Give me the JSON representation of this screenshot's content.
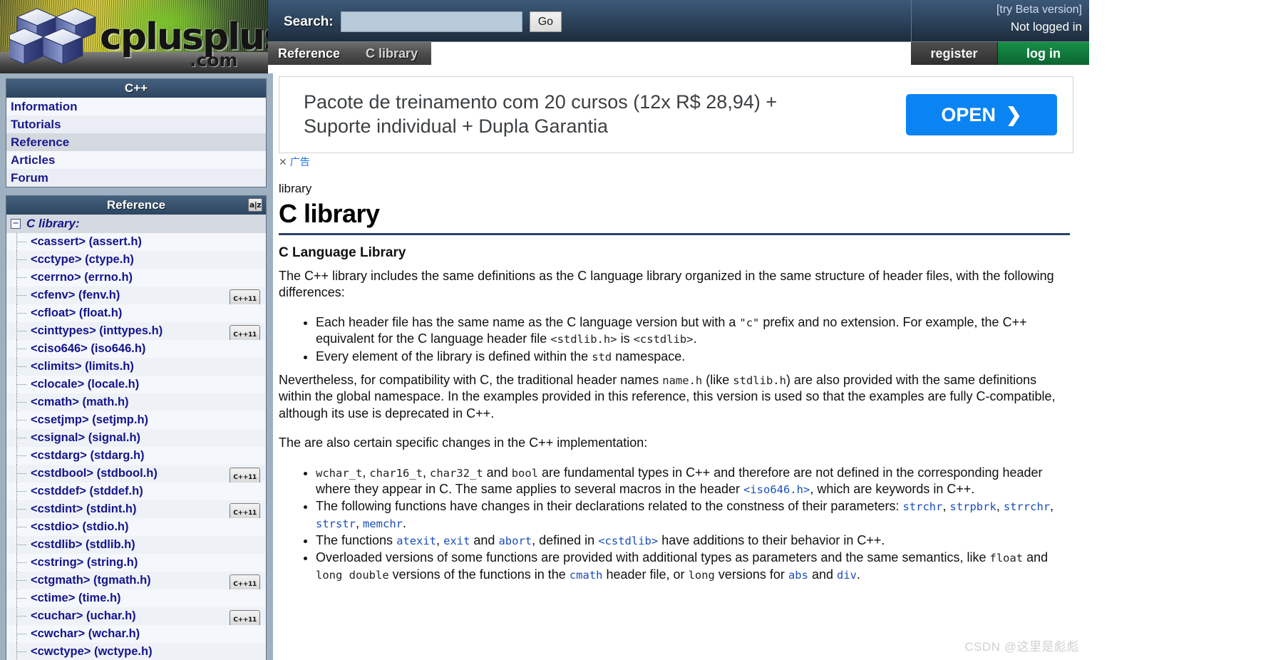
{
  "site": {
    "logo_wordmark": "cplusplus",
    "logo_tld": ".com"
  },
  "header": {
    "search_label": "Search:",
    "search_value": "",
    "search_placeholder": "",
    "go_label": "Go",
    "beta_link": "[try Beta version]",
    "login_status": "Not logged in",
    "register_label": "register",
    "login_label": "log in"
  },
  "tabs": [
    {
      "label": "Reference",
      "current": false
    },
    {
      "label": "C library",
      "current": true
    }
  ],
  "sidebar": {
    "nav_panel": {
      "title": "C++",
      "items": [
        {
          "label": "Information",
          "selected": false
        },
        {
          "label": "Tutorials",
          "selected": false
        },
        {
          "label": "Reference",
          "selected": true
        },
        {
          "label": "Articles",
          "selected": false
        },
        {
          "label": "Forum",
          "selected": false
        }
      ]
    },
    "reference_panel": {
      "title": "Reference",
      "sort_icon": "az-sort-icon",
      "tree_toggle": "−",
      "root_label": "C library:",
      "items": [
        {
          "label": "<cassert> (assert.h)",
          "cpp11": false
        },
        {
          "label": "<cctype> (ctype.h)",
          "cpp11": false
        },
        {
          "label": "<cerrno> (errno.h)",
          "cpp11": false
        },
        {
          "label": "<cfenv> (fenv.h)",
          "cpp11": true
        },
        {
          "label": "<cfloat> (float.h)",
          "cpp11": false
        },
        {
          "label": "<cinttypes> (inttypes.h)",
          "cpp11": true
        },
        {
          "label": "<ciso646> (iso646.h)",
          "cpp11": false
        },
        {
          "label": "<climits> (limits.h)",
          "cpp11": false
        },
        {
          "label": "<clocale> (locale.h)",
          "cpp11": false
        },
        {
          "label": "<cmath> (math.h)",
          "cpp11": false
        },
        {
          "label": "<csetjmp> (setjmp.h)",
          "cpp11": false
        },
        {
          "label": "<csignal> (signal.h)",
          "cpp11": false
        },
        {
          "label": "<cstdarg> (stdarg.h)",
          "cpp11": false
        },
        {
          "label": "<cstdbool> (stdbool.h)",
          "cpp11": true
        },
        {
          "label": "<cstddef> (stddef.h)",
          "cpp11": false
        },
        {
          "label": "<cstdint> (stdint.h)",
          "cpp11": true
        },
        {
          "label": "<cstdio> (stdio.h)",
          "cpp11": false
        },
        {
          "label": "<cstdlib> (stdlib.h)",
          "cpp11": false
        },
        {
          "label": "<cstring> (string.h)",
          "cpp11": false
        },
        {
          "label": "<ctgmath> (tgmath.h)",
          "cpp11": true
        },
        {
          "label": "<ctime> (time.h)",
          "cpp11": false
        },
        {
          "label": "<cuchar> (uchar.h)",
          "cpp11": true
        },
        {
          "label": "<cwchar> (wchar.h)",
          "cpp11": false
        },
        {
          "label": "<cwctype> (wctype.h)",
          "cpp11": false
        }
      ],
      "cpp11_badge": "C++11"
    }
  },
  "ad": {
    "text": "Pacote de treinamento com 20 cursos (12x R$ 28,94) + Suporte individual + Dupla Garantia",
    "open_label": "OPEN",
    "open_arrow": "❯",
    "close_mark": "✕",
    "disclosure": "广告"
  },
  "main": {
    "breadcrumb": "library",
    "title": "C library",
    "section_title": "C Language Library",
    "intro": "The C++ library includes the same definitions as the C language library organized in the same structure of header files, with the following differences:",
    "bullets_1": [
      {
        "parts": [
          {
            "t": "Each header file has the same name as the C language version but with a ",
            "k": "text"
          },
          {
            "t": "\"c\"",
            "k": "code"
          },
          {
            "t": " prefix and no extension. For example, the C++ equivalent for the C language header file ",
            "k": "text"
          },
          {
            "t": "<stdlib.h>",
            "k": "code"
          },
          {
            "t": " is ",
            "k": "text"
          },
          {
            "t": "<cstdlib>",
            "k": "code"
          },
          {
            "t": ".",
            "k": "text"
          }
        ]
      },
      {
        "parts": [
          {
            "t": "Every element of the library is defined within the ",
            "k": "text"
          },
          {
            "t": "std",
            "k": "code"
          },
          {
            "t": " namespace.",
            "k": "text"
          }
        ]
      }
    ],
    "para_2": {
      "parts": [
        {
          "t": "Nevertheless, for compatibility with C, the traditional header names ",
          "k": "text"
        },
        {
          "t": "name.h",
          "k": "code"
        },
        {
          "t": " (like ",
          "k": "text"
        },
        {
          "t": "stdlib.h",
          "k": "code"
        },
        {
          "t": ") are also provided with the same definitions within the global namespace. In the examples provided in this reference, this version is used so that the examples are fully C-compatible, although its use is deprecated in C++.",
          "k": "text"
        }
      ]
    },
    "para_3": "The are also certain specific changes in the C++ implementation:",
    "bullets_2": [
      {
        "parts": [
          {
            "t": "wchar_t",
            "k": "code"
          },
          {
            "t": ", ",
            "k": "text"
          },
          {
            "t": "char16_t",
            "k": "code"
          },
          {
            "t": ", ",
            "k": "text"
          },
          {
            "t": "char32_t",
            "k": "code"
          },
          {
            "t": " and ",
            "k": "text"
          },
          {
            "t": "bool",
            "k": "code"
          },
          {
            "t": " are fundamental types in C++ and therefore are not defined in the corresponding header where they appear in C. The same applies to several macros in the header ",
            "k": "text"
          },
          {
            "t": "<iso646.h>",
            "k": "link"
          },
          {
            "t": ", which are keywords in C++.",
            "k": "text"
          }
        ]
      },
      {
        "parts": [
          {
            "t": "The following functions have changes in their declarations related to the constness of their parameters: ",
            "k": "text"
          },
          {
            "t": "strchr",
            "k": "link"
          },
          {
            "t": ", ",
            "k": "text"
          },
          {
            "t": "strpbrk",
            "k": "link"
          },
          {
            "t": ", ",
            "k": "text"
          },
          {
            "t": "strrchr",
            "k": "link"
          },
          {
            "t": ", ",
            "k": "text"
          },
          {
            "t": "strstr",
            "k": "link"
          },
          {
            "t": ", ",
            "k": "text"
          },
          {
            "t": "memchr",
            "k": "link"
          },
          {
            "t": ".",
            "k": "text"
          }
        ]
      },
      {
        "parts": [
          {
            "t": "The functions ",
            "k": "text"
          },
          {
            "t": "atexit",
            "k": "link"
          },
          {
            "t": ", ",
            "k": "text"
          },
          {
            "t": "exit",
            "k": "link"
          },
          {
            "t": " and ",
            "k": "text"
          },
          {
            "t": "abort",
            "k": "link"
          },
          {
            "t": ", defined in ",
            "k": "text"
          },
          {
            "t": "<cstdlib>",
            "k": "link"
          },
          {
            "t": " have additions to their behavior in C++.",
            "k": "text"
          }
        ]
      },
      {
        "parts": [
          {
            "t": "Overloaded versions of some functions are provided with additional types as parameters and the same semantics, like ",
            "k": "text"
          },
          {
            "t": "float",
            "k": "code"
          },
          {
            "t": " and ",
            "k": "text"
          },
          {
            "t": "long double",
            "k": "code"
          },
          {
            "t": " versions of the functions in the ",
            "k": "text"
          },
          {
            "t": "cmath",
            "k": "link"
          },
          {
            "t": " header file, or ",
            "k": "text"
          },
          {
            "t": "long",
            "k": "code"
          },
          {
            "t": " versions for ",
            "k": "text"
          },
          {
            "t": "abs",
            "k": "link"
          },
          {
            "t": " and ",
            "k": "text"
          },
          {
            "t": "div",
            "k": "link"
          },
          {
            "t": ".",
            "k": "text"
          }
        ]
      }
    ]
  },
  "watermark": "CSDN @这里是彪彪",
  "colors": {
    "header_blue": "#2e465f",
    "accent_rule": "#27406c",
    "link_blue": "#1a4fbb",
    "login_green": "#0c6430",
    "ad_blue": "#0b84f3",
    "sidebar_bg": "#9fb0c0"
  }
}
